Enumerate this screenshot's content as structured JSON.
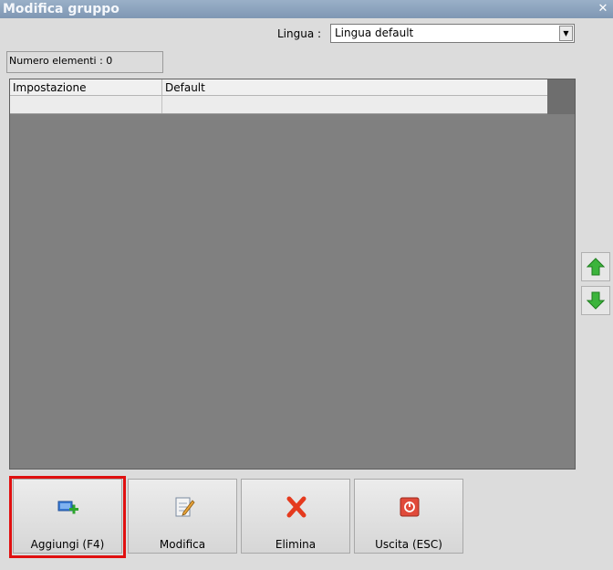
{
  "window": {
    "title": "Modifica gruppo",
    "close_glyph": "✕"
  },
  "language": {
    "label": "Lingua :",
    "selected": "Lingua default",
    "arrow_glyph": "▼"
  },
  "count": {
    "text": "Numero elementi : 0"
  },
  "grid": {
    "columns": [
      "Impostazione",
      "Default"
    ],
    "rows": [
      [
        "",
        ""
      ]
    ]
  },
  "side_buttons": {
    "up_icon": "green-up-arrow-icon",
    "down_icon": "green-down-arrow-icon"
  },
  "buttons": [
    {
      "label": "Aggiungi (F4)",
      "icon": "add-monitor-icon",
      "highlighted": true
    },
    {
      "label": "Modifica",
      "icon": "edit-document-icon"
    },
    {
      "label": "Elimina",
      "icon": "red-x-icon"
    },
    {
      "label": "Uscita (ESC)",
      "icon": "power-exit-icon"
    }
  ],
  "colors": {
    "highlight": "#e01010",
    "arrow_green": "#3cb43c",
    "delete_red": "#e53a1e"
  }
}
